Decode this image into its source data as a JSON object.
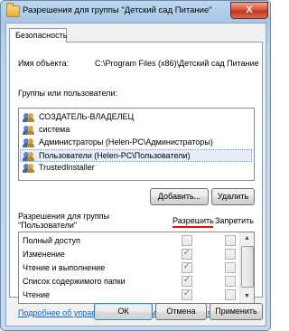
{
  "window": {
    "title": "Разрешения для группы \"Детский сад Питание\"",
    "close_label": "X"
  },
  "tabs": [
    {
      "label": "Безопасность"
    }
  ],
  "object": {
    "name_label": "Имя объекта:",
    "name_value": "C:\\Program Files (x86)\\Детский сад Питание"
  },
  "groups": {
    "label": "Группы или пользователи:",
    "items": [
      {
        "label": "СОЗДАТЕЛЬ-ВЛАДЕЛЕЦ",
        "selected": false
      },
      {
        "label": "система",
        "selected": false
      },
      {
        "label": "Администраторы (Helen-PC\\Администраторы)",
        "selected": false
      },
      {
        "label": "Пользователи (Helen-PC\\Пользователи)",
        "selected": true
      },
      {
        "label": "TrustedInstaller",
        "selected": false
      }
    ],
    "add_button": "Добавить...",
    "remove_button": "Удалить"
  },
  "permissions": {
    "label_line1": "Разрешения для группы",
    "label_line2": "\"Пользователи\"",
    "allow_header": "Разрешить",
    "deny_header": "Запретить",
    "rows": [
      {
        "name": "Полный доступ",
        "allow": false,
        "deny": false
      },
      {
        "name": "Изменение",
        "allow": true,
        "deny": false
      },
      {
        "name": "Чтение и выполнение",
        "allow": true,
        "deny": false
      },
      {
        "name": "Список содержимого папки",
        "allow": true,
        "deny": false
      },
      {
        "name": "Чтение",
        "allow": true,
        "deny": false
      }
    ]
  },
  "help_link": "Подробнее об управлении доступом и разрешениях",
  "footer": {
    "ok": "ОК",
    "cancel": "Отмена",
    "apply": "Применить"
  },
  "colors": {
    "accent_underline": "#ff0000",
    "link": "#0066cc",
    "close_button": "#c4341c"
  }
}
